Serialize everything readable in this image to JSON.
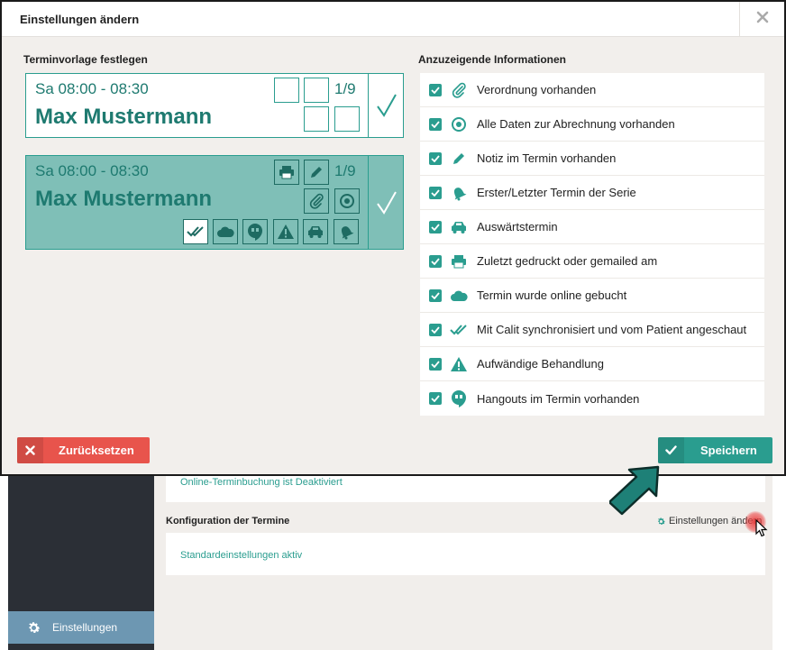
{
  "modal": {
    "title": "Einstellungen ändern",
    "close_label": "×",
    "left_title": "Terminvorlage festlegen",
    "right_title": "Anzuzeigende Informationen",
    "template": {
      "time": "Sa 08:00 - 08:30",
      "name": "Max Mustermann",
      "count": "1/9"
    },
    "info_items": [
      {
        "label": "Verordnung vorhanden",
        "icon": "paperclip-icon",
        "checked": true
      },
      {
        "label": "Alle Daten zur Abrechnung vorhanden",
        "icon": "target-circle-icon",
        "checked": true
      },
      {
        "label": "Notiz im Termin vorhanden",
        "icon": "pencil-icon",
        "checked": true
      },
      {
        "label": "Erster/Letzter Termin der Serie",
        "icon": "bell-icon",
        "checked": true
      },
      {
        "label": "Auswärtstermin",
        "icon": "car-icon",
        "checked": true
      },
      {
        "label": "Zuletzt gedruckt oder gemailed am",
        "icon": "printer-icon",
        "checked": true
      },
      {
        "label": "Termin wurde online gebucht",
        "icon": "cloud-icon",
        "checked": true
      },
      {
        "label": "Mit Calit synchronisiert und vom Patient angeschaut",
        "icon": "double-check-icon",
        "checked": true
      },
      {
        "label": "Aufwändige Behandlung",
        "icon": "warning-icon",
        "checked": true
      },
      {
        "label": "Hangouts im Termin vorhanden",
        "icon": "hangouts-icon",
        "checked": true
      }
    ],
    "reset_label": "Zurücksetzen",
    "save_label": "Speichern"
  },
  "background": {
    "online_booking_status": "Online-Terminbuchung ist Deaktiviert",
    "config_title": "Konfiguration der Termine",
    "config_link": "Einstellungen ändern",
    "default_settings": "Standardeinstellungen aktiv",
    "sidebar_item": "Einstellungen"
  },
  "colors": {
    "accent": "#2a9d8f",
    "template_selected_bg": "#7fbfb7",
    "danger": "#e8544c"
  }
}
